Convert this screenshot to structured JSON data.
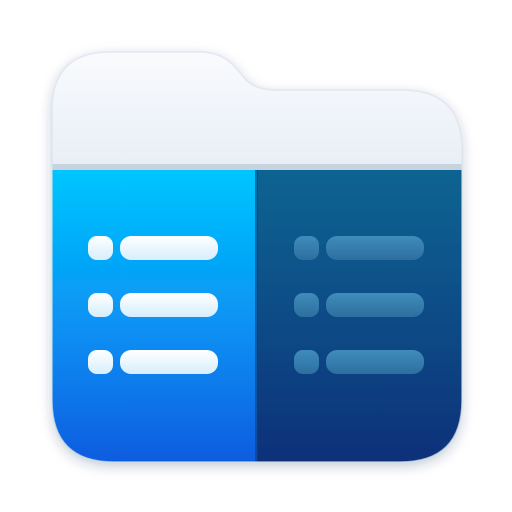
{
  "icon": {
    "name": "dual-pane-file-manager-app-icon",
    "colors": {
      "folder_tab_light": "#f4f7fb",
      "folder_tab_shadow": "#c9d3de",
      "left_pane_top": "#00c2ff",
      "left_pane_bottom": "#0a5fe0",
      "right_pane_top": "#0b5f8e",
      "right_pane_bottom": "#08307a",
      "left_list_marks": "#eaf6ff",
      "right_list_marks": "#3f87b6"
    },
    "left_pane": {
      "rows": 3
    },
    "right_pane": {
      "rows": 3
    }
  }
}
